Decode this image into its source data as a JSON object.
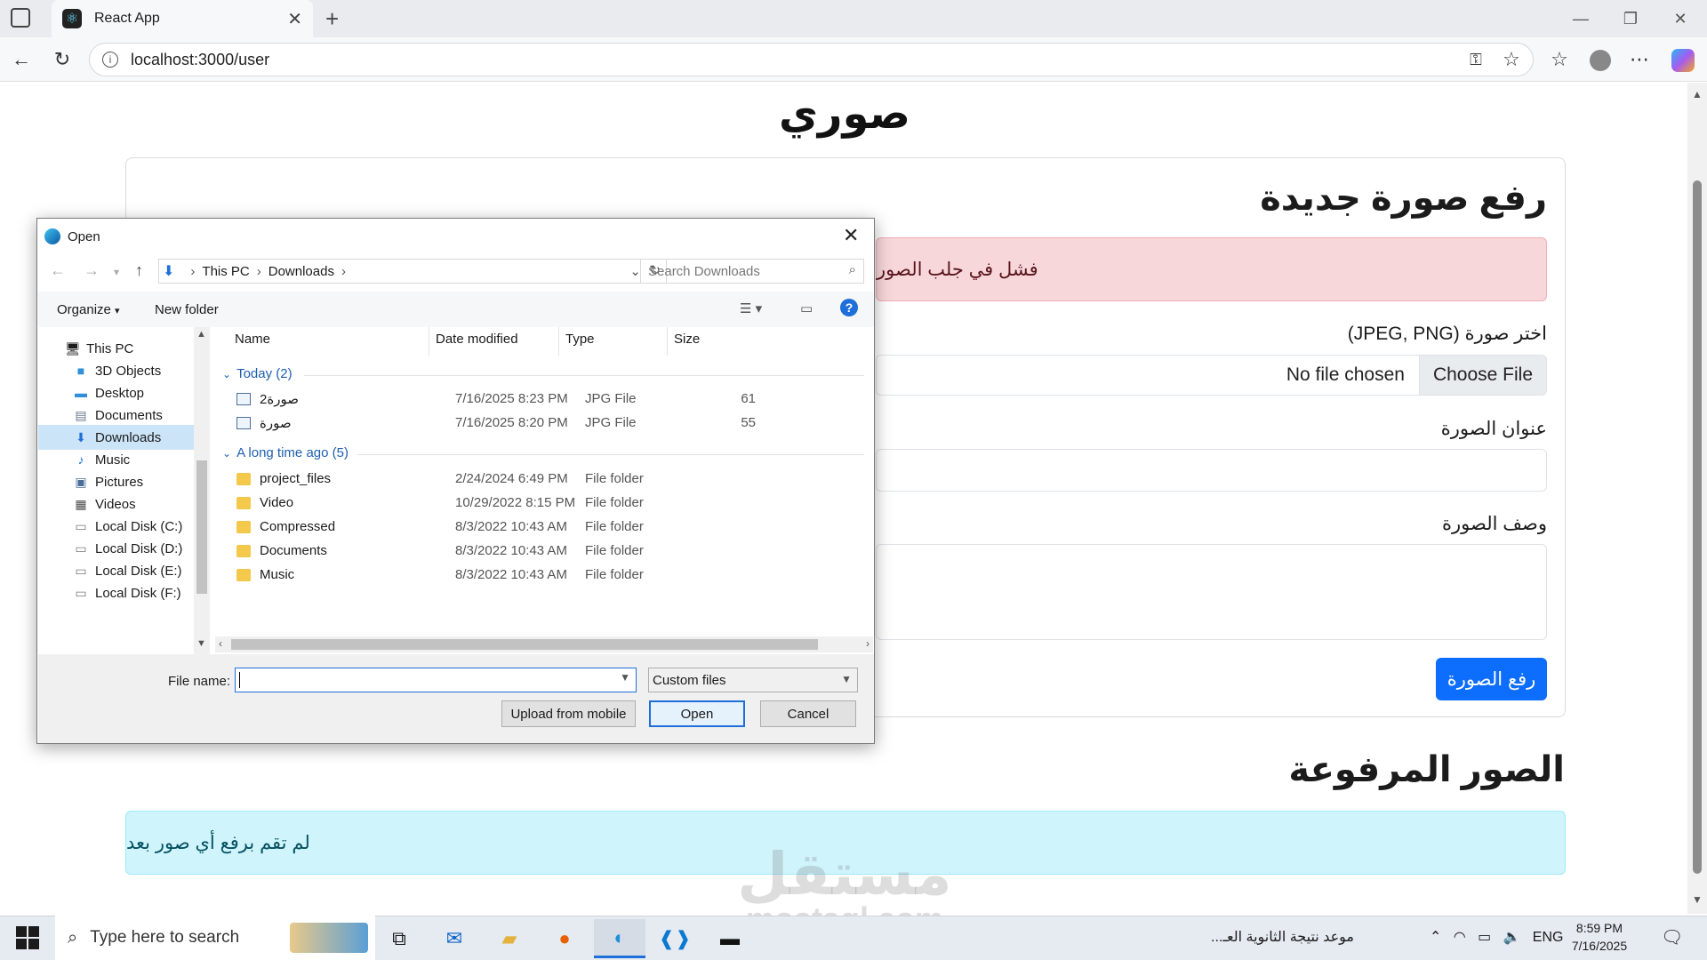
{
  "browser": {
    "tab_title": "React App",
    "url": "localhost:3000/user"
  },
  "page": {
    "title": "صوري",
    "upload_card_title": "رفع صورة جديدة",
    "error_alert": "فشل في جلب الصور",
    "choose_image_label": "اختر صورة (JPEG, PNG)",
    "no_file_text": "No file chosen",
    "choose_file_button": "Choose File",
    "image_title_label": "عنوان الصورة",
    "image_desc_label": "وصف الصورة",
    "upload_button": "رفع الصورة",
    "uploaded_title": "الصور المرفوعة",
    "info_alert": "لم تقم برفع أي صور بعد",
    "watermark_top": "مستقل",
    "watermark_bottom": "mostaql.com"
  },
  "dialog": {
    "title": "Open",
    "breadcrumb": [
      "This PC",
      "Downloads"
    ],
    "search_placeholder": "Search Downloads",
    "organize": "Organize",
    "new_folder": "New folder",
    "nav_items": [
      {
        "label": "This PC",
        "icon": "pc-icon"
      },
      {
        "label": "3D Objects",
        "icon": "cube-icon"
      },
      {
        "label": "Desktop",
        "icon": "desktop-icon"
      },
      {
        "label": "Documents",
        "icon": "document-icon"
      },
      {
        "label": "Downloads",
        "icon": "download-icon",
        "selected": true
      },
      {
        "label": "Music",
        "icon": "music-icon"
      },
      {
        "label": "Pictures",
        "icon": "pictures-icon"
      },
      {
        "label": "Videos",
        "icon": "video-icon"
      },
      {
        "label": "Local Disk (C:)",
        "icon": "disk-icon"
      },
      {
        "label": "Local Disk (D:)",
        "icon": "disk-icon"
      },
      {
        "label": "Local Disk (E:)",
        "icon": "disk-icon"
      },
      {
        "label": "Local Disk (F:)",
        "icon": "disk-icon"
      }
    ],
    "columns": {
      "name": "Name",
      "date": "Date modified",
      "type": "Type",
      "size": "Size"
    },
    "groups": [
      {
        "label": "Today (2)",
        "files": [
          {
            "name": "صورة2",
            "date": "7/16/2025 8:23 PM",
            "type": "JPG File",
            "size": "61",
            "icon": "jpg"
          },
          {
            "name": "صورة",
            "date": "7/16/2025 8:20 PM",
            "type": "JPG File",
            "size": "55",
            "icon": "jpg"
          }
        ]
      },
      {
        "label": "A long time ago (5)",
        "files": [
          {
            "name": "project_files",
            "date": "2/24/2024 6:49 PM",
            "type": "File folder",
            "size": "",
            "icon": "folder"
          },
          {
            "name": "Video",
            "date": "10/29/2022 8:15 PM",
            "type": "File folder",
            "size": "",
            "icon": "folder"
          },
          {
            "name": "Compressed",
            "date": "8/3/2022 10:43 AM",
            "type": "File folder",
            "size": "",
            "icon": "folder"
          },
          {
            "name": "Documents",
            "date": "8/3/2022 10:43 AM",
            "type": "File folder",
            "size": "",
            "icon": "folder"
          },
          {
            "name": "Music",
            "date": "8/3/2022 10:43 AM",
            "type": "File folder",
            "size": "",
            "icon": "folder"
          }
        ]
      }
    ],
    "file_name_label": "File name:",
    "file_name_value": "",
    "file_type": "Custom files",
    "upload_from_mobile": "Upload from mobile",
    "open_button": "Open",
    "cancel_button": "Cancel"
  },
  "taskbar": {
    "search_placeholder": "Type here to search",
    "news": "موعد نتيجة الثانوية العـ...",
    "lang": "ENG",
    "time": "8:59 PM",
    "date": "7/16/2025"
  }
}
